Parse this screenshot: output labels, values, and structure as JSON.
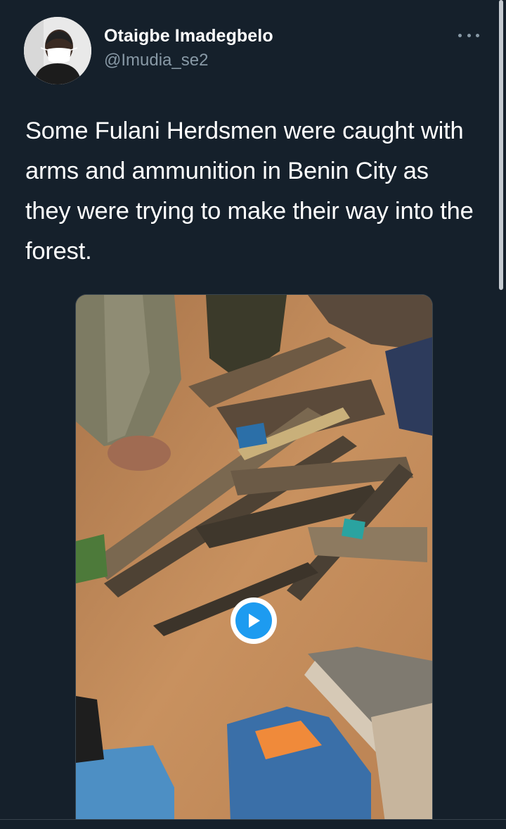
{
  "user": {
    "display_name": "Otaigbe Imadegbelo",
    "handle": "@Imudia_se2",
    "avatar_icon": "user-avatar-photo"
  },
  "tweet": {
    "text": "Some Fulani Herdsmen were caught with arms and ammunition in Benin City as they were trying to make their way into the forest."
  },
  "media": {
    "type": "video",
    "play_icon": "play-icon"
  },
  "menu": {
    "icon": "more-options-icon"
  },
  "colors": {
    "background": "#15202b",
    "text": "#ffffff",
    "secondary_text": "#8899a6",
    "accent": "#1d9bf0"
  }
}
